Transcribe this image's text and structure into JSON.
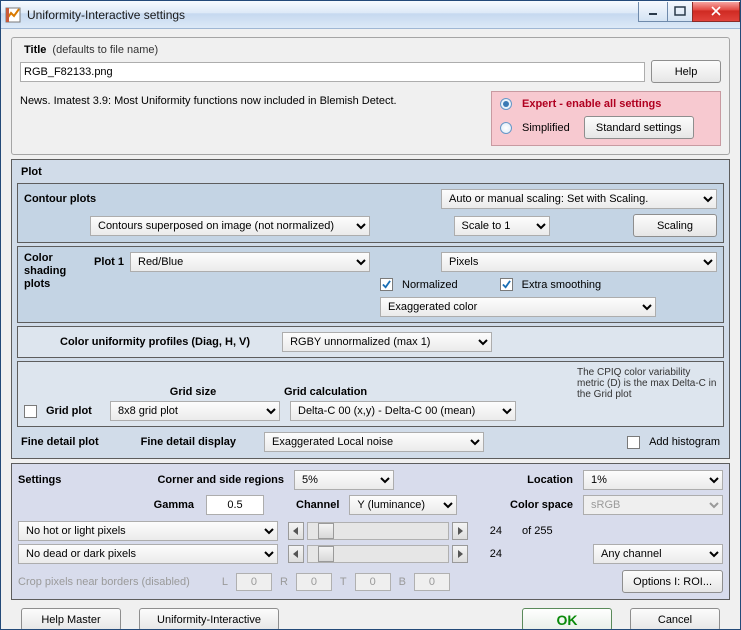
{
  "window": {
    "title": "Uniformity-Interactive settings"
  },
  "title_section": {
    "label": "Title",
    "hint": "(defaults to file name)",
    "value": "RGB_F82133.png",
    "help": "Help"
  },
  "news": "News. Imatest 3.9:  Most Uniformity functions now included in Blemish Detect.",
  "mode": {
    "expert": "Expert - enable all settings",
    "simplified": "Simplified",
    "standard_btn": "Standard settings"
  },
  "plot": {
    "heading": "Plot",
    "contour_label": "Contour plots",
    "contour_superposed": "Contours superposed on image (not normalized)",
    "auto_manual": "Auto or manual scaling: Set with Scaling.",
    "scale_to": "Scale to 1",
    "scaling_btn": "Scaling",
    "plot1_label": "Plot 1",
    "plot1_value": "Red/Blue",
    "color_shading_label": "Color shading plots",
    "pixels": "Pixels",
    "normalized": "Normalized",
    "extra_smoothing": "Extra smoothing",
    "exagg_color": "Exaggerated color",
    "uniformity_profiles_label": "Color uniformity profiles (Diag, H, V)",
    "uniformity_profiles_value": "RGBY unnormalized (max 1)",
    "grid_plot_cb": "Grid plot",
    "grid_size_label": "Grid size",
    "grid_size_value": "8x8  grid plot",
    "grid_calc_label": "Grid calculation",
    "grid_calc_value": "Delta-C 00 (x,y) - Delta-C 00 (mean)",
    "cpiq_note": "The CPIQ color variability metric (D) is the max Delta-C in the Grid plot",
    "fine_detail_plot": "Fine detail plot",
    "fine_detail_display": "Fine detail display",
    "fine_detail_value": "Exaggerated Local noise",
    "add_histogram": "Add histogram"
  },
  "settings": {
    "heading": "Settings",
    "corner_label": "Corner and side regions",
    "corner_value": "5%",
    "location_label": "Location",
    "location_value": "1%",
    "gamma_label": "Gamma",
    "gamma_value": "0.5",
    "channel_label": "Channel",
    "channel_value": "Y (luminance)",
    "colorspace_label": "Color space",
    "colorspace_value": "sRGB",
    "hot_pixels": "No hot or light pixels",
    "dead_pixels": "No dead or dark pixels",
    "val24a": "24",
    "of255": "of  255",
    "val24b": "24",
    "any_channel": "Any channel",
    "crop_label": "Crop pixels near borders (disabled)",
    "L": "L",
    "R": "R",
    "T": "T",
    "B": "B",
    "zero": "0",
    "options_btn": "Options I: ROI..."
  },
  "footer": {
    "help_master": "Help Master",
    "uniformity": "Uniformity-Interactive",
    "ok": "OK",
    "cancel": "Cancel"
  }
}
